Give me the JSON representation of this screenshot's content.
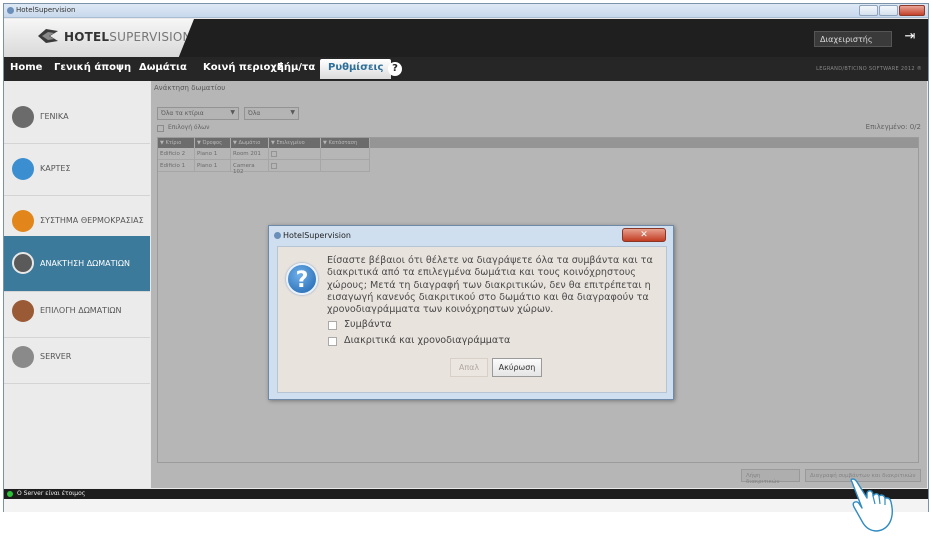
{
  "window": {
    "title": "HotelSupervision"
  },
  "header": {
    "brand_bold": "HOTEL",
    "brand_light": "SUPERVISION",
    "user": "Διαχειριστής",
    "small_brand": "LEGRAND/BTICINO SOFTWARE 2012 ®"
  },
  "menu": {
    "items": [
      {
        "label": "Home"
      },
      {
        "label": "Γενική άποψη"
      },
      {
        "label": "Δωμάτια"
      },
      {
        "label": "Κοινή περιοχή"
      },
      {
        "label": "Σήμ/τα"
      },
      {
        "label": "Ρυθμίσεις"
      }
    ],
    "help": "?"
  },
  "sidebar": {
    "items": [
      {
        "label": "ΓΕΝΙΚΑ",
        "icon": "wrench-icon",
        "color": "#6b6b6b"
      },
      {
        "label": "ΚΑΡΤΕΣ",
        "icon": "card-icon",
        "color": "#3b8fd0"
      },
      {
        "label": "ΣΥΣΤΗΜΑ ΘΕΡΜΟΚΡΑΣΙΑΣ",
        "icon": "thermometer-icon",
        "color": "#e2861b"
      },
      {
        "label": "ΑΝΑΚΤΗΣΗ ΔΩΜΑΤΙΩΝ",
        "icon": "recovery-icon",
        "color": "#5a5a5a"
      },
      {
        "label": "ΕΠΙΛΟΓΗ ΔΩΜΑΤΙΩΝ",
        "icon": "rooms-icon",
        "color": "#9a5a36"
      },
      {
        "label": "SERVER",
        "icon": "server-icon",
        "color": "#8a8a8a"
      }
    ]
  },
  "content": {
    "breadcrumb": "Ανάκτηση δωματίου",
    "filter1": "Όλα τα κτίρια",
    "filter2": "Όλα",
    "select_all": "Επιλογή όλων",
    "selected": "Επιλεγμένο: 0/2",
    "columns": [
      "Κτίριο",
      "Όροφος",
      "Δωμάτιο",
      "Επιλεγμένο",
      "Κατάσταση"
    ],
    "rows": [
      {
        "building": "Edificio 2",
        "floor": "Piano 1",
        "room": "Room 201"
      },
      {
        "building": "Edificio 1",
        "floor": "Piano 1",
        "room": "Camera 102"
      }
    ],
    "btn_release": "Λήψη διακριτικών",
    "btn_delete_all": "Διαγραφή συμβάντων και διακριτικών"
  },
  "dialog": {
    "title": "HotelSupervision",
    "message": "Είσαστε βέβαιοι ότι θέλετε να διαγράψετε όλα τα συμβάντα και τα διακριτικά από τα επιλεγμένα δωμάτια και τους κοινόχρηστους χώρους; Μετά τη διαγραφή των διακριτικών, δεν θα επιτρέπεται η εισαγωγή κανενός διακριτικού στο δωμάτιο και θα διαγραφούν τα χρονοδιαγράμματα των κοινόχρηστων χώρων.",
    "check_events": "Συμβάντα",
    "check_tokens": "Διακριτικά και χρονοδιαγράμματα",
    "btn_delete": "Απαλ",
    "btn_cancel": "Ακύρωση"
  },
  "status": {
    "text": "Ο Server είναι έτοιμος",
    "color": "#2ec23a"
  }
}
